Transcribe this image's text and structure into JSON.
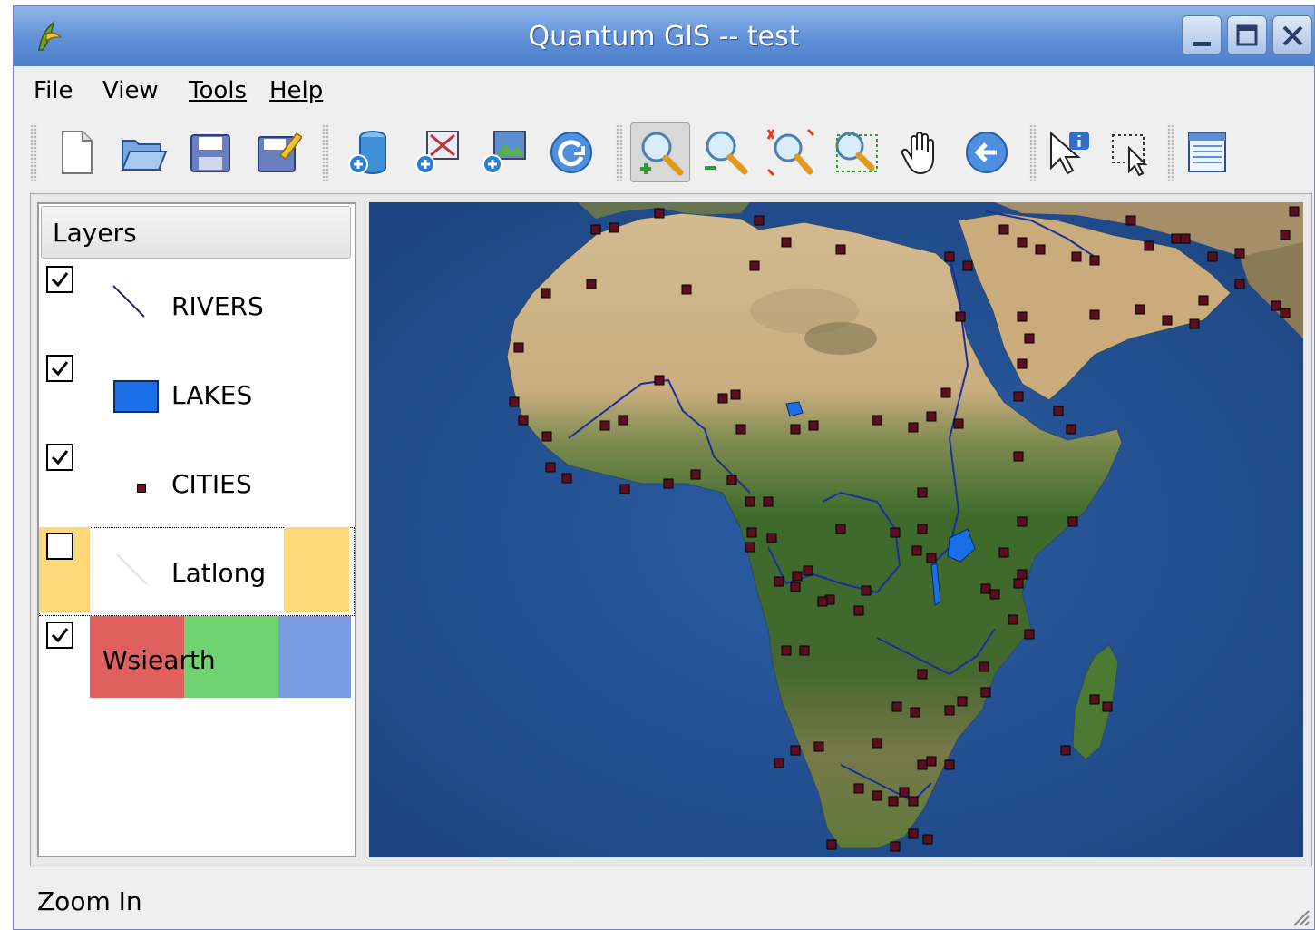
{
  "window": {
    "title": "Quantum GIS -- test"
  },
  "menubar": {
    "items": [
      {
        "label": "File"
      },
      {
        "label": "View"
      },
      {
        "label": "Tools"
      },
      {
        "label": "Help"
      }
    ]
  },
  "toolbar": {
    "buttons": [
      {
        "name": "new-project-icon"
      },
      {
        "name": "open-project-icon"
      },
      {
        "name": "save-project-icon"
      },
      {
        "name": "save-as-icon"
      },
      {
        "name": "add-database-layer-icon"
      },
      {
        "name": "add-vector-layer-icon"
      },
      {
        "name": "add-raster-layer-icon"
      },
      {
        "name": "refresh-icon"
      },
      {
        "name": "zoom-in-icon",
        "active": true
      },
      {
        "name": "zoom-out-icon"
      },
      {
        "name": "zoom-full-icon"
      },
      {
        "name": "zoom-to-selection-icon"
      },
      {
        "name": "pan-hand-icon"
      },
      {
        "name": "zoom-previous-icon"
      },
      {
        "name": "identify-icon"
      },
      {
        "name": "select-features-icon"
      },
      {
        "name": "attribute-table-icon"
      }
    ]
  },
  "legend": {
    "header": "Layers",
    "layers": [
      {
        "name": "RIVERS",
        "checked": true,
        "symbol": "line"
      },
      {
        "name": "LAKES",
        "checked": true,
        "symbol": "polygon",
        "color": "#1a6fe8"
      },
      {
        "name": "CITIES",
        "checked": true,
        "symbol": "point",
        "color": "#6b1424"
      },
      {
        "name": "Latlong",
        "checked": false,
        "symbol": "line",
        "selected": true,
        "highlight": "#fdd97a"
      },
      {
        "name": "Wsiearth",
        "checked": true,
        "symbol": "raster",
        "bands": [
          "#e06060",
          "#6fd46f",
          "#7b9be0"
        ]
      }
    ]
  },
  "map": {
    "ocean_color": "#224d8f",
    "desert_color": "#cdb48a",
    "vegetation_color": "#3f6b2f",
    "river_color": "#1b2f9c",
    "lake_color": "#1a6fe8",
    "city_color": "#5a0f1e"
  },
  "status": {
    "text": "Zoom In"
  }
}
